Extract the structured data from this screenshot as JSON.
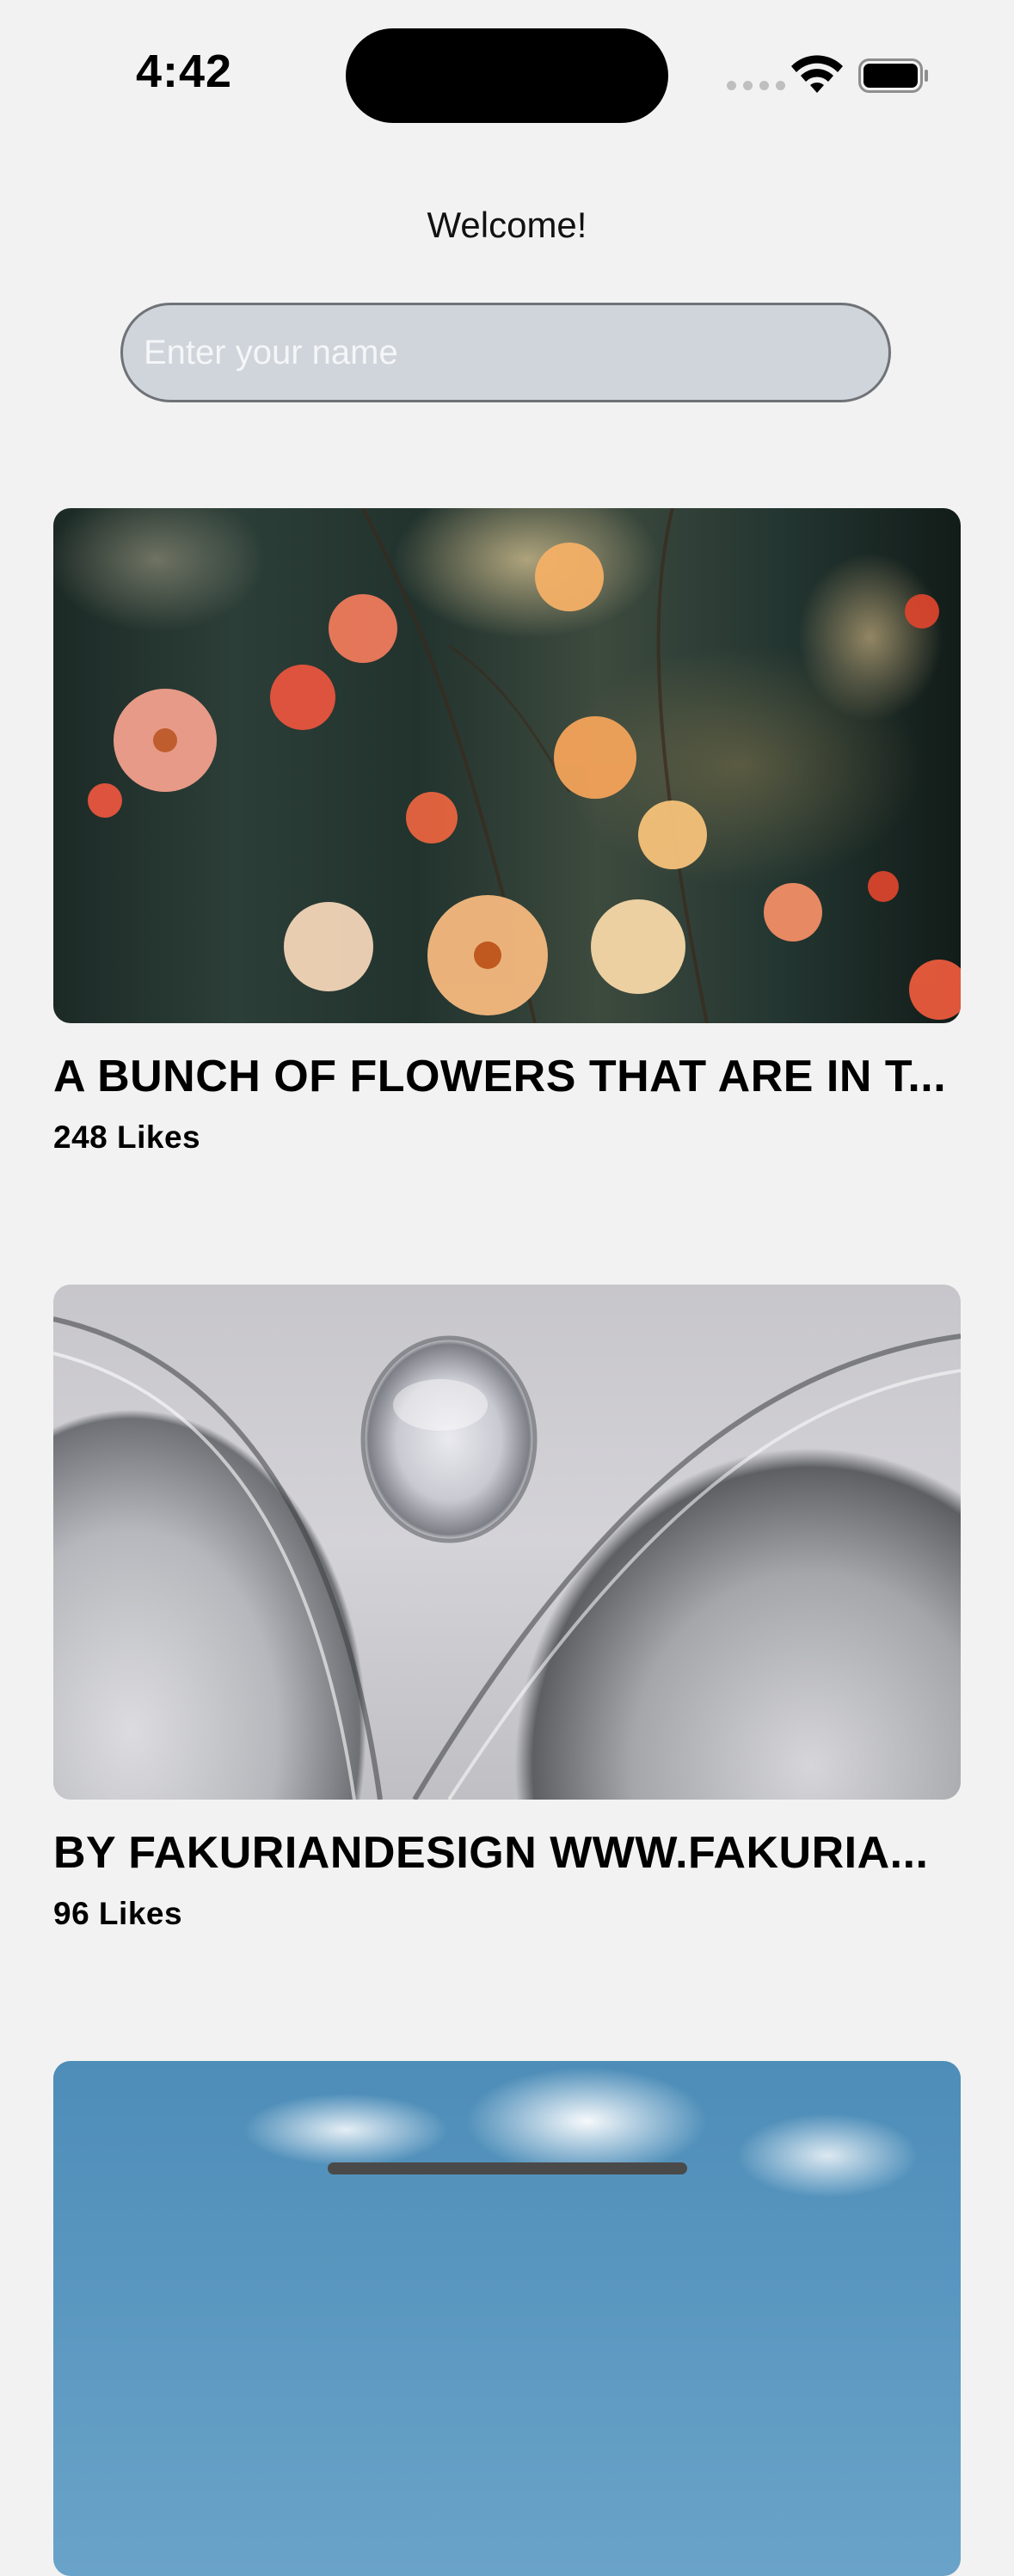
{
  "status_bar": {
    "time": "4:42",
    "icons": [
      "signal-dots-icon",
      "wifi-icon",
      "battery-icon"
    ]
  },
  "header": {
    "welcome": "Welcome!"
  },
  "name_input": {
    "value": "",
    "placeholder": "Enter your name"
  },
  "feed": [
    {
      "image": "flowers-photo",
      "title": "A BUNCH OF FLOWERS THAT ARE IN T...",
      "likes": "248 Likes"
    },
    {
      "image": "glass-abstract-photo",
      "title": "BY FAKURIANDESIGN WWW.FAKURIA...",
      "likes": "96 Likes"
    },
    {
      "image": "sky-clouds-photo",
      "title": "",
      "likes": ""
    }
  ],
  "colors": {
    "background": "#f2f2f2",
    "input_fill": "#d0d5db",
    "input_border": "#6f7378"
  }
}
